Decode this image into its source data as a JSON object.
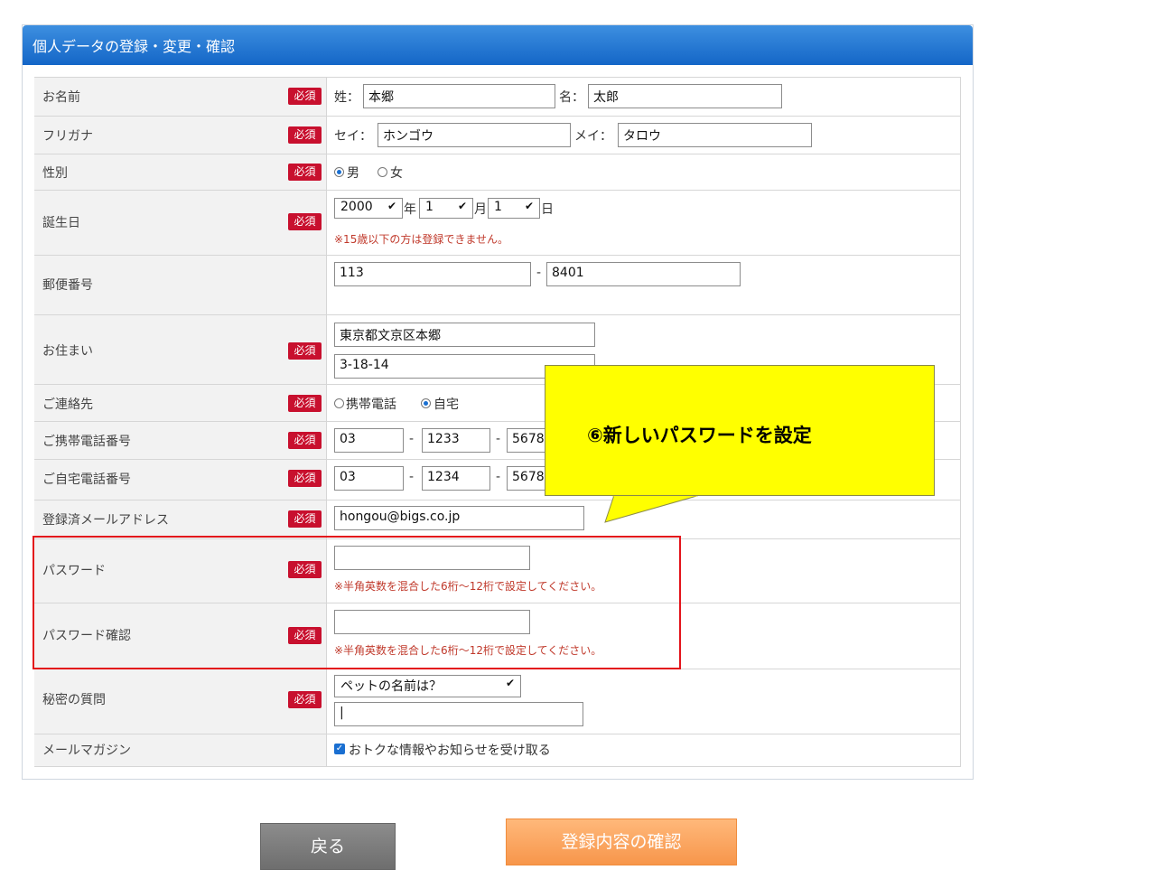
{
  "panel": {
    "title": "個人データの登録・変更・確認"
  },
  "required_label": "必須",
  "rows": {
    "name": {
      "label": "お名前",
      "last_prefix": "姓：",
      "last_value": "本郷",
      "first_prefix": "名：",
      "first_value": "太郎"
    },
    "kana": {
      "label": "フリガナ",
      "last_prefix": "セイ：",
      "last_value": "ホンゴウ",
      "first_prefix": "メイ：",
      "first_value": "タロウ"
    },
    "gender": {
      "label": "性別",
      "options": [
        "男",
        "女"
      ],
      "selected": "男"
    },
    "birthday": {
      "label": "誕生日",
      "year": "2000",
      "year_suffix": "年",
      "month": "1",
      "month_suffix": "月",
      "day": "1",
      "day_suffix": "日",
      "note": "※15歳以下の方は登録できません。"
    },
    "postal": {
      "label": "郵便番号",
      "first": "113",
      "separator": "-",
      "second": "8401"
    },
    "address": {
      "label": "お住まい",
      "line1": "東京都文京区本郷",
      "line2": "3-18-14"
    },
    "contact": {
      "label": "ご連絡先",
      "options": [
        "携帯電話",
        "自宅"
      ],
      "selected": "自宅"
    },
    "mobile": {
      "label": "ご携帯電話番号",
      "part1": "03",
      "part2": "1233",
      "part3": "5678",
      "separator": "-"
    },
    "home": {
      "label": "ご自宅電話番号",
      "part1": "03",
      "part2": "1234",
      "part3": "5678",
      "separator": "-"
    },
    "email": {
      "label": "登録済メールアドレス",
      "value": "hongou@bigs.co.jp"
    },
    "password": {
      "label": "パスワード",
      "value": "",
      "note": "※半角英数を混合した6桁～12桁で設定してください。"
    },
    "password_confirm": {
      "label": "パスワード確認",
      "value": "",
      "note": "※半角英数を混合した6桁～12桁で設定してください。"
    },
    "secret": {
      "label": "秘密の質問",
      "question": "ペットの名前は？",
      "answer": "|"
    },
    "newsletter": {
      "label": "メールマガジン",
      "checkbox_label": "おトクな情報やお知らせを受け取る",
      "checked": true
    }
  },
  "callout": {
    "text": "⑥新しいパスワードを設定"
  },
  "buttons": {
    "back": "戻る",
    "confirm": "登録内容の確認"
  },
  "colors": {
    "header": "#1f74d3",
    "required_badge": "#c8102e",
    "highlight_border": "#e3141b",
    "callout_bg": "#ffff00",
    "confirm_button": "#f7964b",
    "back_button": "#7a7a7a"
  }
}
